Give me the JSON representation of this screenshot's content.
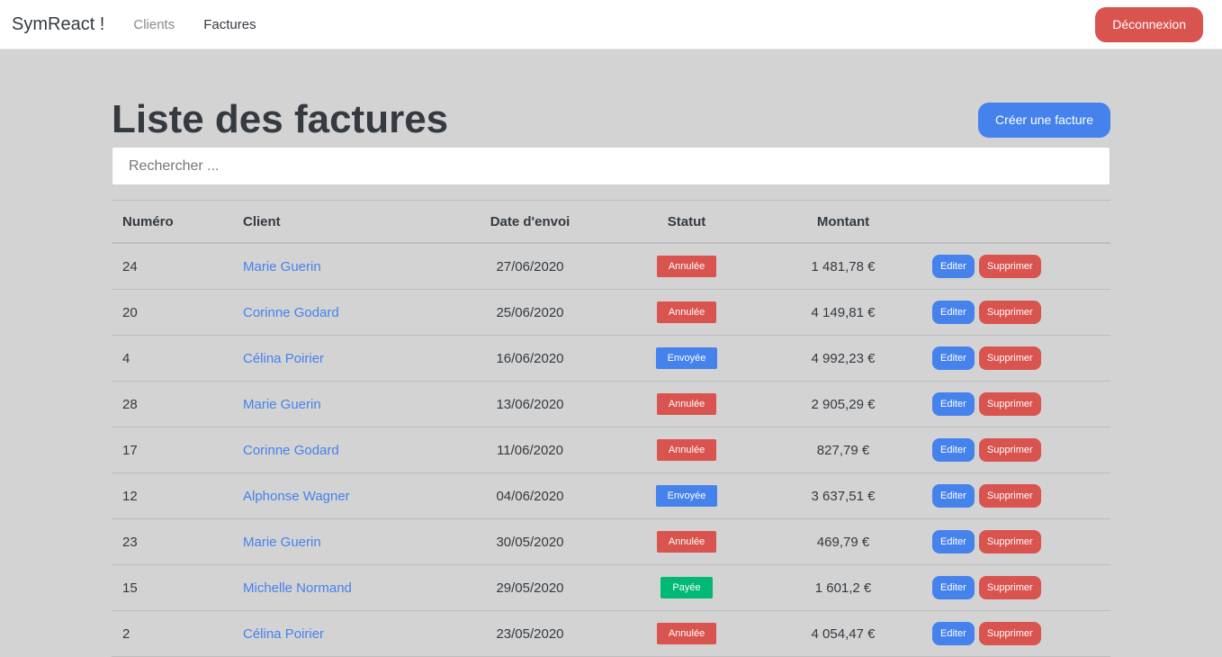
{
  "navbar": {
    "brand": "SymReact !",
    "links": [
      {
        "label": "Clients",
        "active": false
      },
      {
        "label": "Factures",
        "active": true
      }
    ],
    "logout_label": "Déconnexion"
  },
  "page": {
    "title": "Liste des factures",
    "create_label": "Créer une facture",
    "search_placeholder": "Rechercher ..."
  },
  "table": {
    "headers": {
      "number": "Numéro",
      "client": "Client",
      "date": "Date d'envoi",
      "status": "Statut",
      "amount": "Montant"
    },
    "edit_label": "Editer",
    "delete_label": "Supprimer",
    "rows": [
      {
        "number": "24",
        "client": "Marie Guerin",
        "date": "27/06/2020",
        "status": "Annulée",
        "status_color": "#d9534f",
        "amount": "1 481,78 €"
      },
      {
        "number": "20",
        "client": "Corinne Godard",
        "date": "25/06/2020",
        "status": "Annulée",
        "status_color": "#d9534f",
        "amount": "4 149,81 €"
      },
      {
        "number": "4",
        "client": "Célina Poirier",
        "date": "16/06/2020",
        "status": "Envoyée",
        "status_color": "#4582ec",
        "amount": "4 992,23 €"
      },
      {
        "number": "28",
        "client": "Marie Guerin",
        "date": "13/06/2020",
        "status": "Annulée",
        "status_color": "#d9534f",
        "amount": "2 905,29 €"
      },
      {
        "number": "17",
        "client": "Corinne Godard",
        "date": "11/06/2020",
        "status": "Annulée",
        "status_color": "#d9534f",
        "amount": "827,79 €"
      },
      {
        "number": "12",
        "client": "Alphonse Wagner",
        "date": "04/06/2020",
        "status": "Envoyée",
        "status_color": "#4582ec",
        "amount": "3 637,51 €"
      },
      {
        "number": "23",
        "client": "Marie Guerin",
        "date": "30/05/2020",
        "status": "Annulée",
        "status_color": "#d9534f",
        "amount": "469,79 €"
      },
      {
        "number": "15",
        "client": "Michelle Normand",
        "date": "29/05/2020",
        "status": "Payée",
        "status_color": "#02b875",
        "amount": "1 601,2 €"
      },
      {
        "number": "2",
        "client": "Célina Poirier",
        "date": "23/05/2020",
        "status": "Annulée",
        "status_color": "#d9534f",
        "amount": "4 054,47 €"
      }
    ]
  }
}
